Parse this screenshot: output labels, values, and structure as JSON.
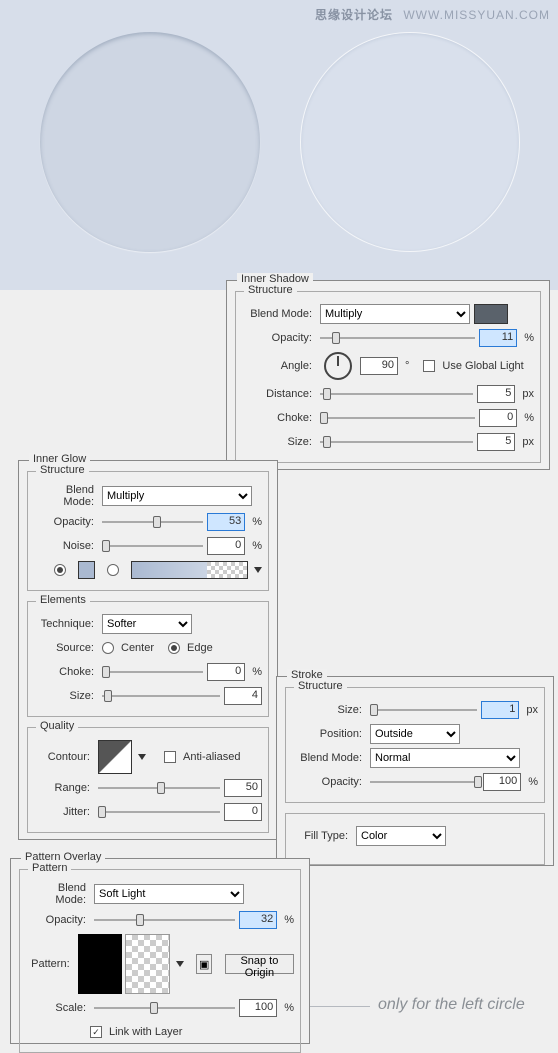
{
  "watermark": {
    "cn": "思缘设计论坛",
    "en": "WWW.MISSYUAN.COM"
  },
  "innerShadow": {
    "title": "Inner Shadow",
    "structure": "Structure",
    "blendModeLabel": "Blend Mode:",
    "blendMode": "Multiply",
    "swatch": "#5a626b",
    "opacityLabel": "Opacity:",
    "opacity": "11",
    "opacityUnit": "%",
    "angleLabel": "Angle:",
    "angle": "90",
    "angleUnit": "°",
    "useGlobalLabel": "Use Global Light",
    "distanceLabel": "Distance:",
    "distance": "5",
    "chokeLabel": "Choke:",
    "choke": "0",
    "sizeLabel": "Size:",
    "size": "5",
    "px": "px",
    "pct": "%"
  },
  "innerGlow": {
    "title": "Inner Glow",
    "structure": "Structure",
    "blendModeLabel": "Blend Mode:",
    "blendMode": "Multiply",
    "opacityLabel": "Opacity:",
    "opacity": "53",
    "pct": "%",
    "noiseLabel": "Noise:",
    "noise": "0",
    "elements": "Elements",
    "techniqueLabel": "Technique:",
    "technique": "Softer",
    "sourceLabel": "Source:",
    "srcCenter": "Center",
    "srcEdge": "Edge",
    "chokeLabel": "Choke:",
    "choke": "0",
    "sizeLabel": "Size:",
    "size": "4",
    "quality": "Quality",
    "contourLabel": "Contour:",
    "antiAliased": "Anti-aliased",
    "rangeLabel": "Range:",
    "range": "50",
    "jitterLabel": "Jitter:",
    "jitter": "0"
  },
  "stroke": {
    "title": "Stroke",
    "structure": "Structure",
    "sizeLabel": "Size:",
    "size": "1",
    "px": "px",
    "positionLabel": "Position:",
    "position": "Outside",
    "blendModeLabel": "Blend Mode:",
    "blendMode": "Normal",
    "opacityLabel": "Opacity:",
    "opacity": "100",
    "pct": "%",
    "fillTypeLabel": "Fill Type:",
    "fillType": "Color"
  },
  "pattern": {
    "title": "Pattern Overlay",
    "group": "Pattern",
    "blendModeLabel": "Blend Mode:",
    "blendMode": "Soft Light",
    "opacityLabel": "Opacity:",
    "opacity": "32",
    "pct": "%",
    "patternLabel": "Pattern:",
    "snapBtn": "Snap to Origin",
    "scaleLabel": "Scale:",
    "scale": "100",
    "linkLabel": "Link with Layer"
  },
  "caption": "only for the left circle"
}
